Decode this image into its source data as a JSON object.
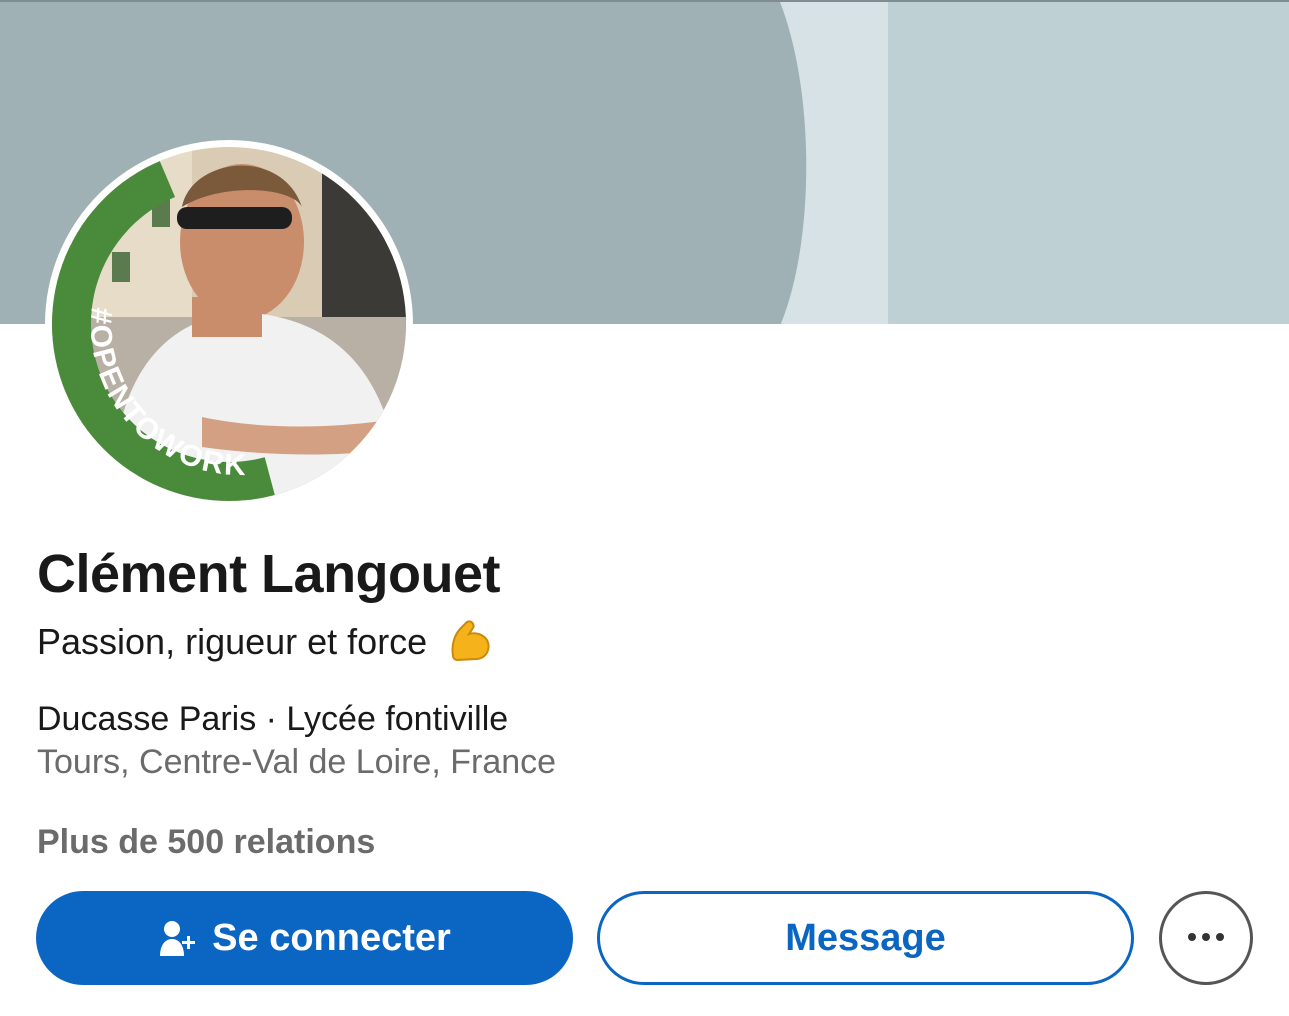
{
  "profile": {
    "name": "Clément Langouet",
    "headline": "Passion, rigueur et force",
    "headline_emoji": "flexed-biceps-emoji",
    "work": "Ducasse Paris · Lycée fontiville",
    "location": "Tours, Centre-Val de Loire, France",
    "connections": "Plus de 500 relations",
    "badge": "#OPENTOWORK"
  },
  "actions": {
    "connect_label": "Se connecter",
    "message_label": "Message",
    "more_icon": "more-dots-icon",
    "connect_icon": "add-person-icon"
  },
  "colors": {
    "primary": "#0a66c2",
    "banner_dark": "#9fb1b4",
    "banner_light": "#bfd0d5",
    "opentowork_green": "#4a8b3b"
  }
}
